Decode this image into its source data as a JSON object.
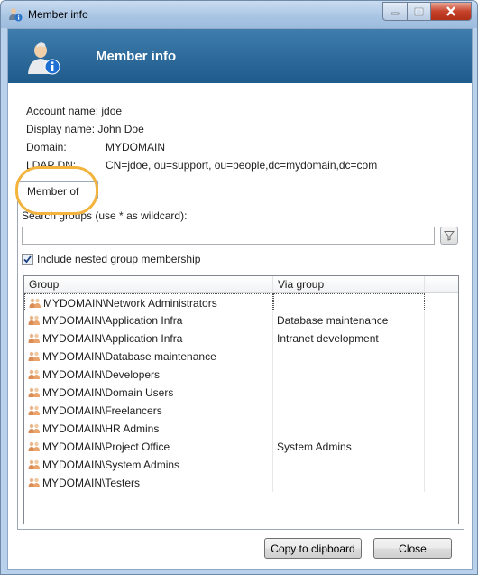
{
  "window": {
    "title": "Member info"
  },
  "banner": {
    "title": "Member info"
  },
  "account": {
    "account_name_label": "Account name:",
    "account_name": "jdoe",
    "display_name_label": "Display name:",
    "display_name": "John Doe",
    "domain_label": "Domain:",
    "domain": "MYDOMAIN",
    "ldap_label": "LDAP DN:",
    "ldap_dn": "CN=jdoe, ou=support, ou=people,dc=mydomain,dc=com"
  },
  "tab": {
    "label": "Member of"
  },
  "search": {
    "label": "Search groups (use * as wildcard):",
    "value": ""
  },
  "nested": {
    "label": "Include nested group membership",
    "checked": true
  },
  "list": {
    "columns": [
      "Group",
      "Via group"
    ],
    "rows": [
      {
        "group": "MYDOMAIN\\Network Administrators",
        "via": ""
      },
      {
        "group": "MYDOMAIN\\Application Infra",
        "via": "Database maintenance"
      },
      {
        "group": "MYDOMAIN\\Application Infra",
        "via": "Intranet development"
      },
      {
        "group": "MYDOMAIN\\Database maintenance",
        "via": ""
      },
      {
        "group": "MYDOMAIN\\Developers",
        "via": ""
      },
      {
        "group": "MYDOMAIN\\Domain Users",
        "via": ""
      },
      {
        "group": "MYDOMAIN\\Freelancers",
        "via": ""
      },
      {
        "group": "MYDOMAIN\\HR Admins",
        "via": ""
      },
      {
        "group": "MYDOMAIN\\Project Office",
        "via": "System Admins"
      },
      {
        "group": "MYDOMAIN\\System Admins",
        "via": ""
      },
      {
        "group": "MYDOMAIN\\Testers",
        "via": ""
      }
    ]
  },
  "buttons": {
    "copy": "Copy to clipboard",
    "close": "Close"
  },
  "colors": {
    "banner": "#2b6a9c",
    "highlight": "#f3b33d",
    "close_button": "#c7432b"
  }
}
